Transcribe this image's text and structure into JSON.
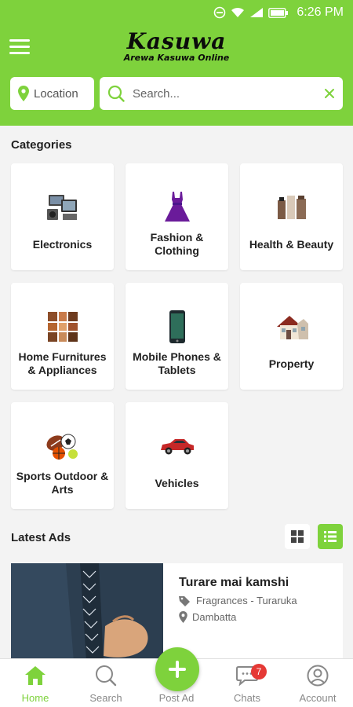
{
  "status_bar": {
    "time": "6:26 PM"
  },
  "header": {
    "logo_title": "Kasuwa",
    "logo_subtitle": "Arewa Kasuwa Online",
    "location_label": "Location",
    "search_placeholder": "Search..."
  },
  "categories": {
    "title": "Categories",
    "items": [
      {
        "label": "Electronics",
        "icon": "electronics-icon"
      },
      {
        "label": "Fashion & Clothing",
        "icon": "dress-icon"
      },
      {
        "label": "Health & Beauty",
        "icon": "health-beauty-icon"
      },
      {
        "label": "Home Furnitures & Appliances",
        "icon": "furniture-icon"
      },
      {
        "label": "Mobile Phones & Tablets",
        "icon": "phone-icon"
      },
      {
        "label": "Property",
        "icon": "house-icon"
      },
      {
        "label": "Sports Outdoor & Arts",
        "icon": "sports-balls-icon"
      },
      {
        "label": "Vehicles",
        "icon": "car-icon"
      }
    ]
  },
  "latest_ads": {
    "title": "Latest Ads",
    "ad": {
      "title": "Turare mai kamshi",
      "category": "Fragrances - Turaruka",
      "location": "Dambatta"
    }
  },
  "bottom_nav": {
    "home": "Home",
    "search": "Search",
    "post_ad": "Post Ad",
    "chats": "Chats",
    "chats_badge": "7",
    "account": "Account"
  },
  "colors": {
    "brand_green": "#7ed23c",
    "badge_red": "#e53935"
  }
}
